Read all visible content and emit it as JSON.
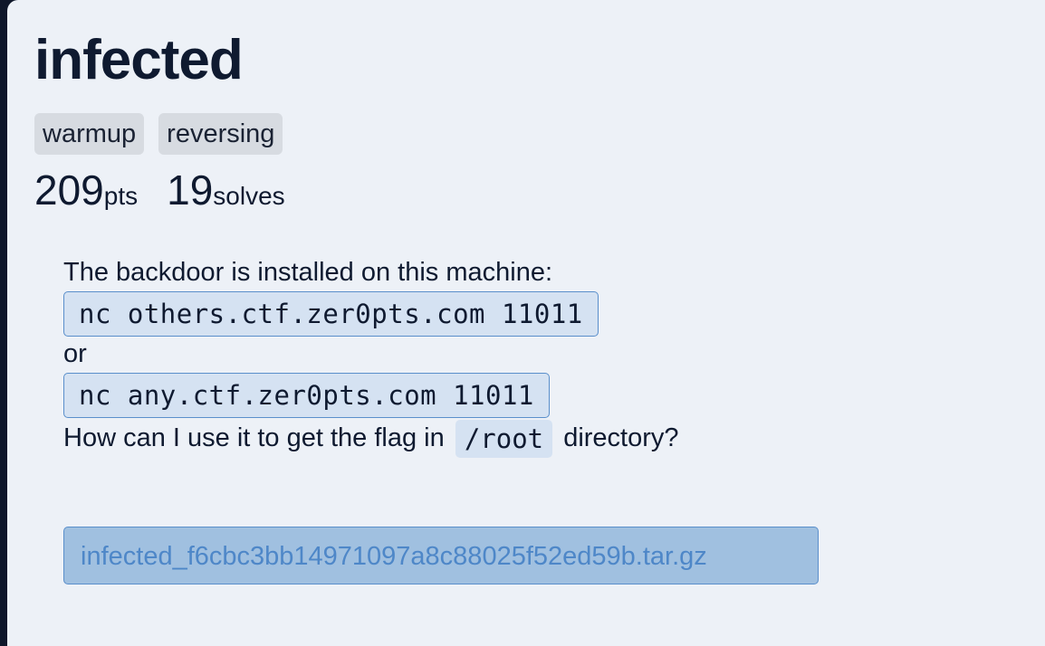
{
  "challenge": {
    "title": "infected",
    "tags": [
      "warmup",
      "reversing"
    ],
    "points": "209",
    "points_unit": "pts",
    "solves": "19",
    "solves_unit": "solves"
  },
  "description": {
    "line1": "The backdoor is installed on this machine:",
    "code1": "nc others.ctf.zer0pts.com 11011",
    "or": "or",
    "code2": "nc any.ctf.zer0pts.com 11011",
    "question_before": "How can I use it to get the flag in",
    "question_code": "/root",
    "question_after": "directory?"
  },
  "attachment": {
    "filename": "infected_f6cbc3bb14971097a8c88025f52ed59b.tar.gz"
  }
}
